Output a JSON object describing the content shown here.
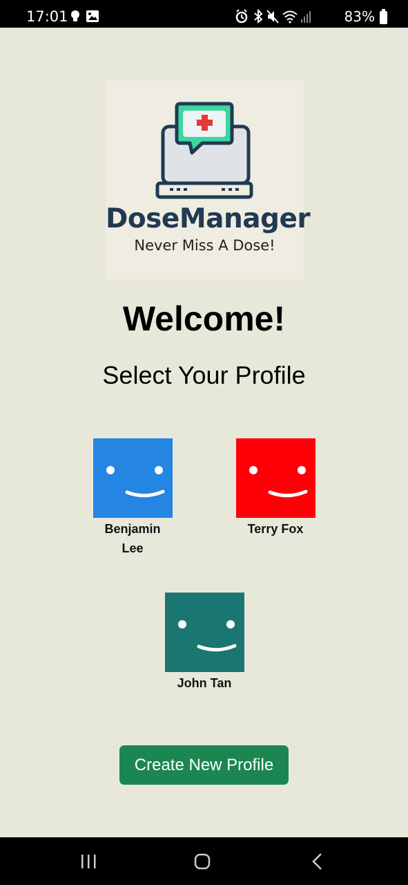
{
  "status_bar": {
    "time": "17:01",
    "battery": "83%",
    "left_icons": [
      "lightbulb-icon",
      "image-icon"
    ],
    "right_icons": [
      "alarm-icon",
      "bluetooth-icon",
      "mute-icon",
      "wifi-icon",
      "signal-icon",
      "battery-icon"
    ]
  },
  "logo": {
    "name": "DoseManager",
    "tagline": "Never Miss A Dose!",
    "icon": "laptop-medical-chat-icon",
    "colors": {
      "navy": "#213a52",
      "mint": "#3dd6a0",
      "red": "#e53935",
      "screen": "#dfe3e8"
    }
  },
  "header": {
    "welcome": "Welcome!",
    "subtitle": "Select Your Profile"
  },
  "profiles": [
    {
      "name": "Benjamin Lee",
      "color": "#2486e2",
      "icon": "smiley-face-icon"
    },
    {
      "name": "Terry Fox",
      "color": "#ff0009",
      "icon": "smiley-face-icon"
    },
    {
      "name": "John Tan",
      "color": "#1b7570",
      "icon": "smiley-face-icon"
    }
  ],
  "actions": {
    "create_profile_label": "Create New Profile",
    "create_profile_color": "#1c8653"
  },
  "nav_bar": {
    "icons": [
      "recent-apps-icon",
      "home-icon",
      "back-icon"
    ]
  },
  "theme": {
    "background": "#e8e8da"
  }
}
